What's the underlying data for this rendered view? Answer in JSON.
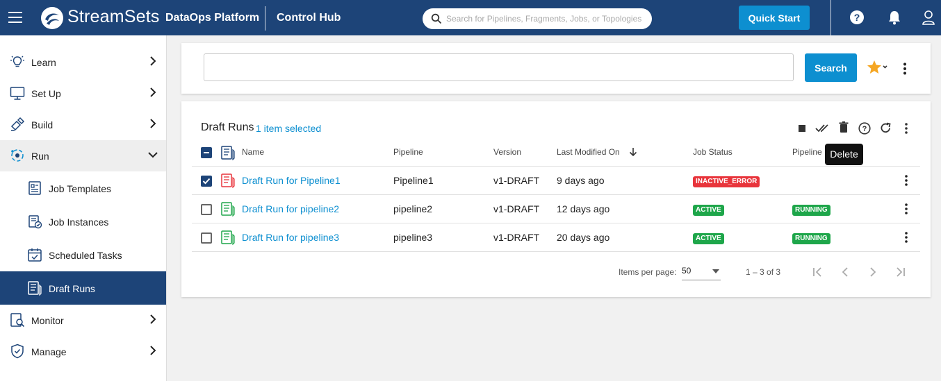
{
  "topbar": {
    "brand": "StreamSets",
    "platform": "DataOps Platform",
    "hub": "Control Hub",
    "search_placeholder": "Search for Pipelines, Fragments, Jobs, or Topologies",
    "quick_start": "Quick Start",
    "colors": {
      "bar": "#1d4478",
      "accent": "#0d8fd0"
    }
  },
  "sidebar": {
    "items": [
      {
        "label": "Learn",
        "icon": "lightbulb-icon"
      },
      {
        "label": "Set Up",
        "icon": "monitor-icon"
      },
      {
        "label": "Build",
        "icon": "build-icon"
      },
      {
        "label": "Run",
        "icon": "run-icon",
        "expanded": true
      },
      {
        "label": "Monitor",
        "icon": "monitor-search-icon"
      },
      {
        "label": "Manage",
        "icon": "shield-icon"
      }
    ],
    "run_children": [
      {
        "label": "Job Templates",
        "icon": "job-template-icon"
      },
      {
        "label": "Job Instances",
        "icon": "job-instances-icon"
      },
      {
        "label": "Scheduled Tasks",
        "icon": "calendar-icon"
      },
      {
        "label": "Draft Runs",
        "icon": "draft-runs-icon",
        "active": true
      }
    ]
  },
  "filter": {
    "value": "",
    "search_label": "Search"
  },
  "table": {
    "title": "Draft Runs",
    "selection": "1 item selected",
    "tooltip": "Delete",
    "columns": [
      "Name",
      "Pipeline",
      "Version",
      "Last Modified On",
      "Job Status",
      "Pipeline"
    ],
    "rows": [
      {
        "name": "Draft Run for Pipeline1",
        "pipeline": "Pipeline1",
        "version": "v1-DRAFT",
        "modified": "9 days ago",
        "job_status": "INACTIVE_ERROR",
        "pipeline_status": "",
        "checked": true
      },
      {
        "name": "Draft Run for pipeline2",
        "pipeline": "pipeline2",
        "version": "v1-DRAFT",
        "modified": "12 days ago",
        "job_status": "ACTIVE",
        "pipeline_status": "RUNNING",
        "checked": false
      },
      {
        "name": "Draft Run for pipeline3",
        "pipeline": "pipeline3",
        "version": "v1-DRAFT",
        "modified": "20 days ago",
        "job_status": "ACTIVE",
        "pipeline_status": "RUNNING",
        "checked": false
      }
    ],
    "status_colors": {
      "error": "#e8343b",
      "ok": "#1ea64a"
    }
  },
  "pager": {
    "items_per_page_label": "Items per page:",
    "items_per_page": "50",
    "range": "1 – 3 of 3"
  }
}
